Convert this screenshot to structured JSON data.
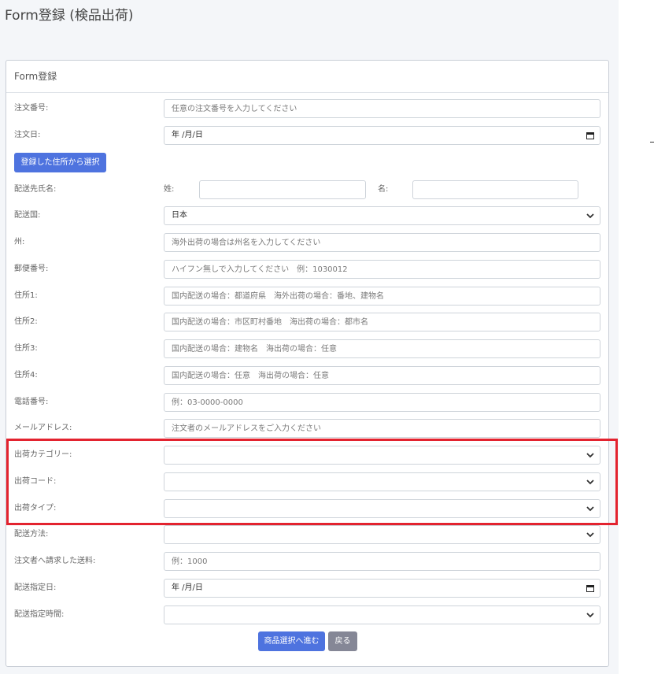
{
  "page": {
    "title": "Form登録 (検品出荷)"
  },
  "card": {
    "header": "Form登録"
  },
  "fields": {
    "order_number": {
      "label": "注文番号:",
      "placeholder": "任意の注文番号を入力してください"
    },
    "order_date": {
      "label": "注文日:",
      "value": "年 /月/日"
    },
    "select_address_button": "登録した住所から選択",
    "recipient_name": {
      "label": "配送先氏名:",
      "last_label": "姓:",
      "first_label": "名:"
    },
    "country": {
      "label": "配送国:",
      "value": "日本"
    },
    "state": {
      "label": "州:",
      "placeholder": "海外出荷の場合は州名を入力してください"
    },
    "postal_code": {
      "label": "郵便番号:",
      "placeholder": "ハイフン無しで入力してください　例：1030012"
    },
    "address1": {
      "label": "住所1:",
      "placeholder": "国内配送の場合：都道府県　海外出荷の場合：番地、建物名"
    },
    "address2": {
      "label": "住所2:",
      "placeholder": "国内配送の場合：市区町村番地　海出荷の場合：都市名"
    },
    "address3": {
      "label": "住所3:",
      "placeholder": "国内配送の場合：建物名　海出荷の場合：任意"
    },
    "address4": {
      "label": "住所4:",
      "placeholder": "国内配送の場合：任意　海出荷の場合：任意"
    },
    "phone": {
      "label": "電話番号:",
      "placeholder": "例：03-0000-0000"
    },
    "email": {
      "label": "メールアドレス:",
      "placeholder": "注文者のメールアドレスをご入力ください"
    },
    "shipping_category": {
      "label": "出荷カテゴリー:",
      "value": ""
    },
    "shipping_code": {
      "label": "出荷コード:",
      "value": ""
    },
    "shipping_type": {
      "label": "出荷タイプ:",
      "value": ""
    },
    "delivery_method": {
      "label": "配送方法:",
      "value": ""
    },
    "shipping_fee": {
      "label": "注文者へ請求した送料:",
      "placeholder": "例：1000"
    },
    "delivery_date": {
      "label": "配送指定日:",
      "value": "年 /月/日"
    },
    "delivery_time": {
      "label": "配送指定時間:",
      "value": ""
    }
  },
  "actions": {
    "next": "商品選択へ進む",
    "back": "戻る"
  },
  "colors": {
    "primary": "#4e73df",
    "secondary": "#858796",
    "highlight": "#e3232f"
  },
  "icons": {
    "select_arrow": "chevron-down-icon",
    "date_picker": "calendar-icon"
  }
}
